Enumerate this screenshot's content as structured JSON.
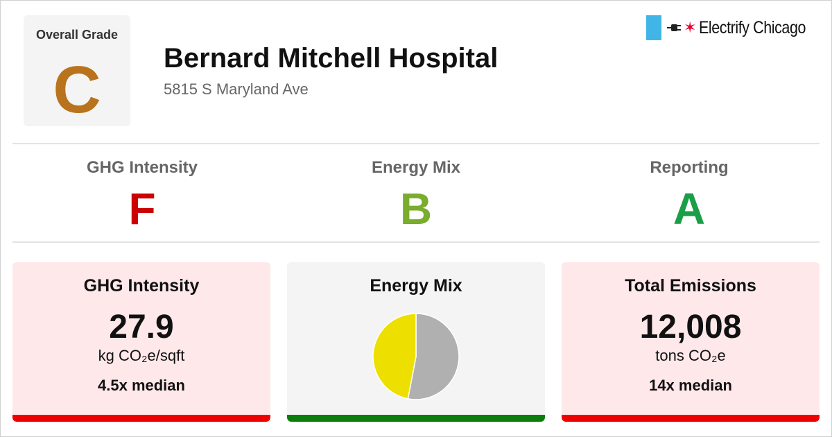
{
  "overall": {
    "label": "Overall Grade",
    "grade": "C",
    "color": "#b8731c"
  },
  "building": {
    "name": "Bernard Mitchell Hospital",
    "address": "5815 S Maryland Ave"
  },
  "brand": {
    "text": "Electrify Chicago",
    "flag_color": "#41b6e6",
    "star_color": "#e4002b",
    "icons": [
      "chicago-flag-stripe-icon",
      "plug-icon",
      "red-star-icon"
    ]
  },
  "subgrades": [
    {
      "label": "GHG Intensity",
      "grade": "F",
      "color": "#cc0000"
    },
    {
      "label": "Energy Mix",
      "grade": "B",
      "color": "#7aac2e"
    },
    {
      "label": "Reporting",
      "grade": "A",
      "color": "#1a9e48"
    }
  ],
  "cards": {
    "ghg": {
      "title": "GHG Intensity",
      "value": "27.9",
      "unit": "kg CO₂e/sqft",
      "median": "4.5x median",
      "background": "#ffe8ea",
      "bar_color": "#ee0000"
    },
    "mix": {
      "title": "Energy Mix",
      "background": "#f4f4f4",
      "bar_color": "#0b7d0b"
    },
    "emissions": {
      "title": "Total Emissions",
      "value": "12,008",
      "unit": "tons CO₂e",
      "median": "14x median",
      "background": "#ffe8ea",
      "bar_color": "#ee0000"
    }
  },
  "chart_data": {
    "type": "pie",
    "slices": [
      {
        "value": 0.53,
        "color": "#b0b0b0"
      },
      {
        "value": 0.47,
        "color": "#ede000"
      }
    ]
  }
}
